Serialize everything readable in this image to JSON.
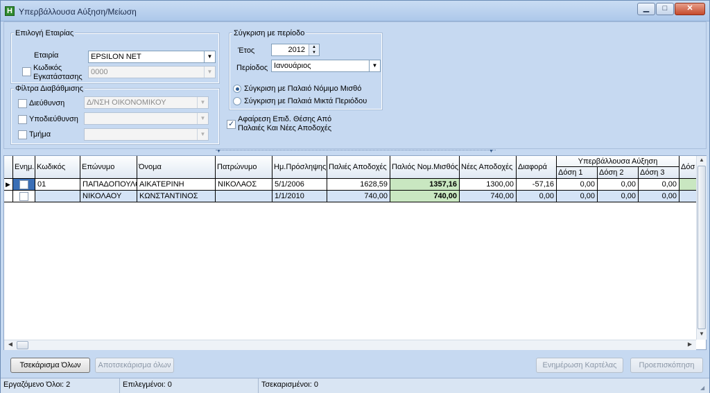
{
  "window": {
    "app_icon_letter": "H",
    "title": "Υπερβάλλουσα Αύξηση/Μείωση",
    "min_glyph": "▁",
    "max_glyph": "□",
    "close_glyph": "✕"
  },
  "company_group": {
    "title": "Επιλογή Εταιρίας",
    "company_label": "Εταιρία",
    "company_value": "EPSILON NET",
    "install_code_label_1": "Κωδικός",
    "install_code_label_2": "Εγκατάστασης",
    "install_code_value": "0000",
    "install_code_checked": false
  },
  "filters_group": {
    "title": "Φίλτρα Διαβάθμισης",
    "direction_label": "Διεύθυνση",
    "direction_value": "Δ/ΝΣΗ ΟΙΚΟΝΟΜΙΚΟΥ",
    "subdirection_label": "Υποδιεύθυνση",
    "subdirection_value": "",
    "department_label": "Τμήμα",
    "department_value": ""
  },
  "period_group": {
    "title": "Σύγκριση με περίοδο",
    "year_label": "Έτος",
    "year_value": "2012",
    "period_label": "Περίοδος",
    "period_value": "Ιανουάριος",
    "radio_legal_label": "Σύγκριση με Παλαιό Νόμιμο Μισθό",
    "radio_gross_label": "Σύγκριση με Παλαιά Μικτά Περιόδου",
    "selected_radio": "legal"
  },
  "deduct_option": {
    "line1": "Αφαίρεση Επιδ. Θέσης Από",
    "line2": "Παλαιές Και Νέες Αποδοχές",
    "checked": true
  },
  "grid": {
    "columns": {
      "enabled": "Ενημ.",
      "code": "Κωδικός",
      "surname": "Επώνυμο",
      "name": "Όνομα",
      "fathers_name": "Πατρώνυμο",
      "hire_date": "Ημ.Πρόσληψης",
      "old_earnings": "Παλιές Αποδοχές",
      "old_legal_salary": "Παλιός Νομ.Μισθός",
      "new_earnings": "Νέες Αποδοχές",
      "difference": "Διαφορά",
      "excess_group": "Υπερβάλλουσα Αύξηση",
      "dose1": "Δόση 1",
      "dose2": "Δόση 2",
      "dose3": "Δόση 3",
      "dose4": "Δόσ"
    },
    "rows": [
      {
        "indicator": "▶",
        "code": "01",
        "surname": "ΠΑΠΑΔΟΠΟΥΛΟΥ",
        "name": "ΑΙΚΑΤΕΡΙΝΗ",
        "fathers_name": "ΝΙΚΟΛΑΟΣ",
        "hire_date": "5/1/2006",
        "old_earnings": "1628,59",
        "old_legal_salary": "1357,16",
        "new_earnings": "1300,00",
        "difference": "-57,16",
        "dose1": "0,00",
        "dose2": "0,00",
        "dose3": "0,00"
      },
      {
        "indicator": "",
        "code": "",
        "surname": "ΝΙΚΟΛΑΟΥ",
        "name": "ΚΩΝΣΤΑΝΤΙΝΟΣ",
        "fathers_name": "",
        "hire_date": "1/1/2010",
        "old_earnings": "740,00",
        "old_legal_salary": "740,00",
        "new_earnings": "740,00",
        "difference": "0,00",
        "dose1": "0,00",
        "dose2": "0,00",
        "dose3": "0,00"
      }
    ]
  },
  "buttons": {
    "check_all": "Τσεκάρισμα Όλων",
    "uncheck_all": "Αποτσεκάρισμα όλων",
    "update_card": "Ενημέρωση Καρτέλας",
    "preview": "Προεπισκόπηση"
  },
  "status": {
    "employees_total": "Εργαζόμενο Όλοι: 2",
    "selected": "Επιλεγμένοι: 0",
    "checked": "Τσεκαρισμένοι: 0"
  },
  "colors": {
    "window_bg": "#c6d9f1",
    "highlight_green": "#c9e7c1",
    "selected_row": "#d4e3f6"
  }
}
